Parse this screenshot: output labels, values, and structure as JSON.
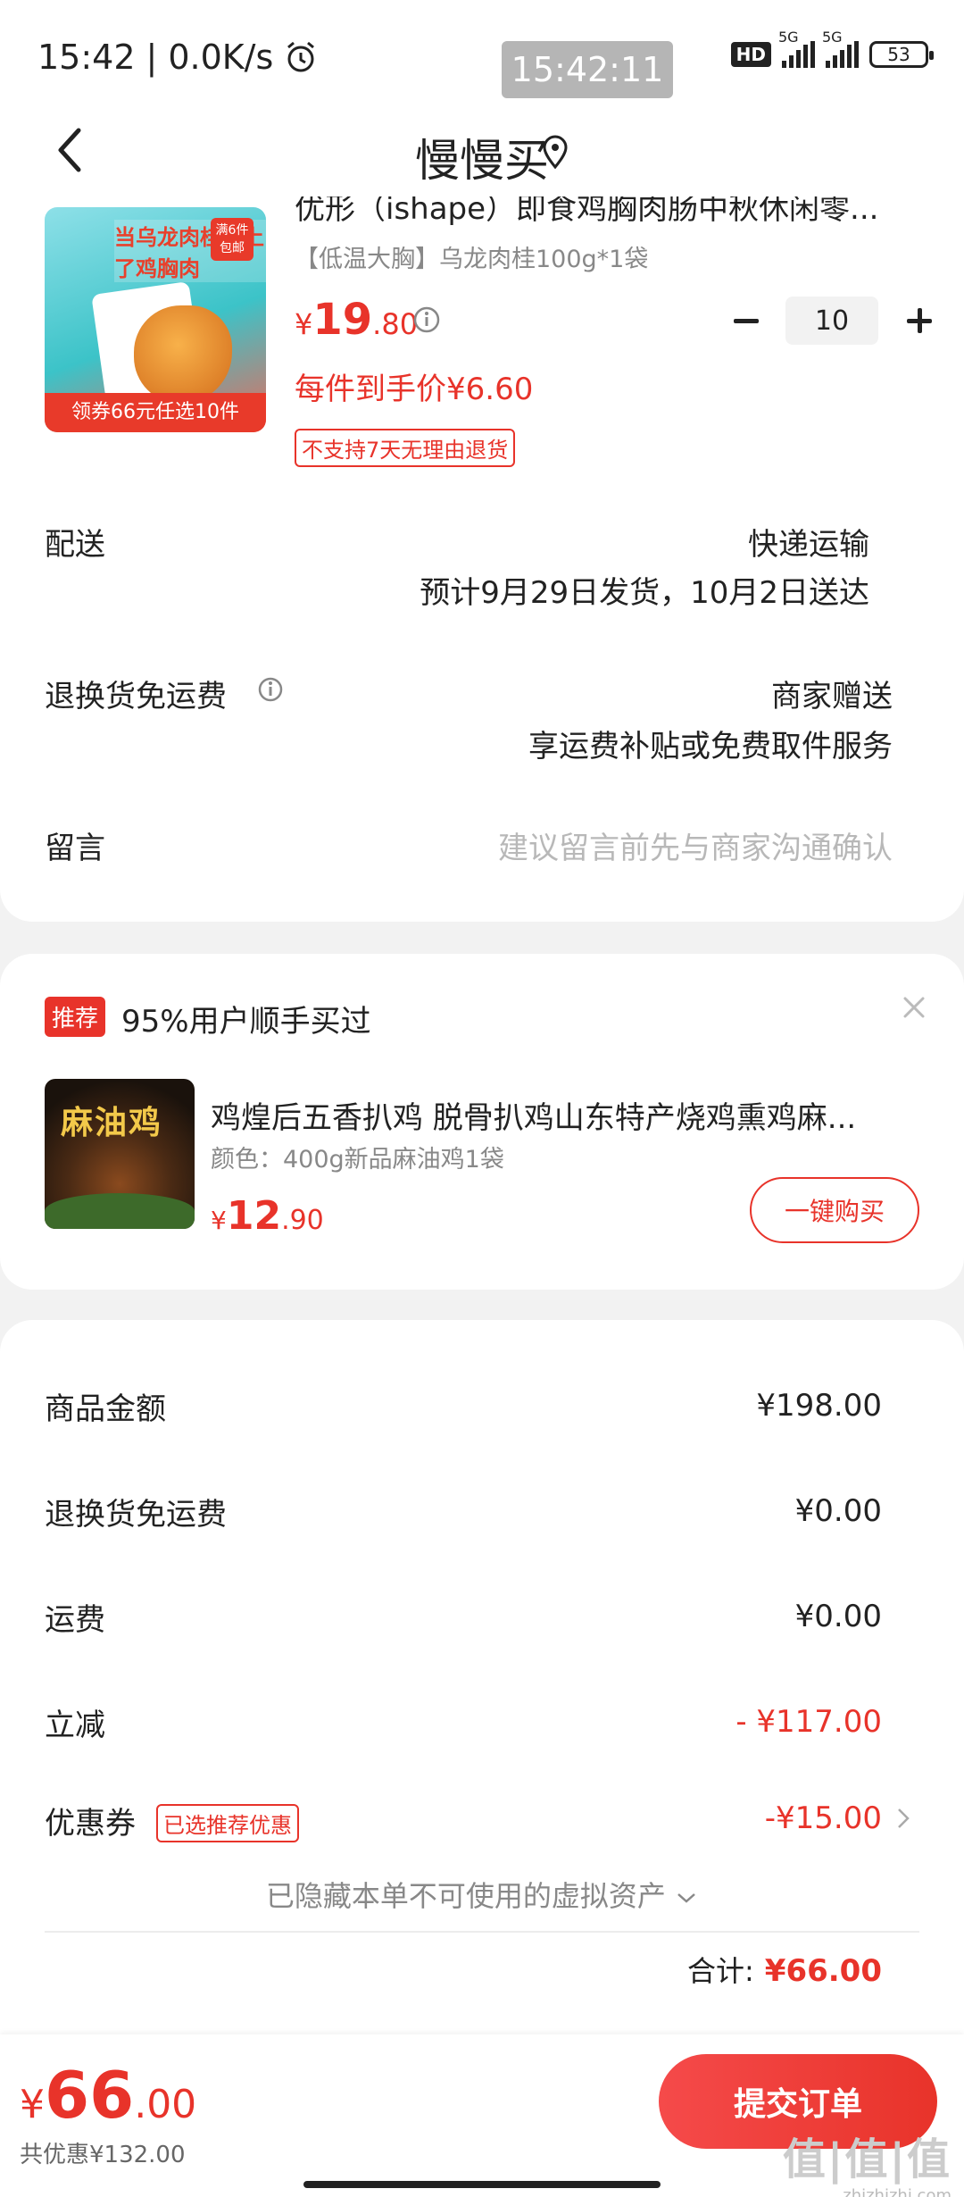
{
  "status_bar": {
    "time": "15:42",
    "net_speed": "0.0K/s",
    "time_pill": "15:42:11",
    "hd": "HD",
    "net1": "5G",
    "net2": "5G",
    "battery": "53"
  },
  "header": {
    "title": "慢慢买"
  },
  "product": {
    "name": "优形（ishape）即食鸡胸肉肠中秋休闲零...",
    "spec": "【低温大胸】乌龙肉桂100g*1袋",
    "price_int": "19",
    "price_dec": ".80",
    "currency": "¥",
    "quantity": "10",
    "unit_price": "每件到手价¥6.60",
    "no_return": "不支持7天无理由退货",
    "image_text_top": "当乌龙肉桂遇上了鸡胸肉",
    "image_badge": "满6件包邮",
    "image_strip": "领券66元任选10件"
  },
  "delivery": {
    "label": "配送",
    "method": "快递运输",
    "eta": "预计9月29日发货，10月2日送达"
  },
  "return_shipping": {
    "label": "退换货免运费",
    "value": "商家赠送",
    "desc": "享运费补贴或免费取件服务"
  },
  "message": {
    "label": "留言",
    "placeholder": "建议留言前先与商家沟通确认"
  },
  "recommend": {
    "tag": "推荐",
    "title": "95%用户顺手买过",
    "name": "鸡煌后五香扒鸡 脱骨扒鸡山东特产烧鸡熏鸡麻...",
    "spec": "颜色：400g新品麻油鸡1袋",
    "price_int": "12",
    "price_dec": ".90",
    "currency": "¥",
    "buy_label": "一键购买",
    "image_text": "麻油鸡"
  },
  "summary": {
    "goods_label": "商品金额",
    "goods_value": "¥198.00",
    "return_label": "退换货免运费",
    "return_value": "¥0.00",
    "shipping_label": "运费",
    "shipping_value": "¥0.00",
    "discount_label": "立减",
    "discount_value": "- ¥117.00",
    "coupon_label": "优惠券",
    "coupon_tag": "已选推荐优惠",
    "coupon_value": "-¥15.00",
    "hidden_note": "已隐藏本单不可使用的虚拟资产",
    "total_label": "合计:",
    "total_value": "¥66.00"
  },
  "bottom": {
    "currency": "¥",
    "price_int": "66",
    "price_dec": ".00",
    "saved": "共优惠¥132.00",
    "submit_label": "提交订单"
  },
  "watermark": {
    "text": "值|值|值",
    "url": "zhizhizhi.com"
  },
  "colors": {
    "accent": "#e8332a",
    "background": "#f2f2f2"
  }
}
